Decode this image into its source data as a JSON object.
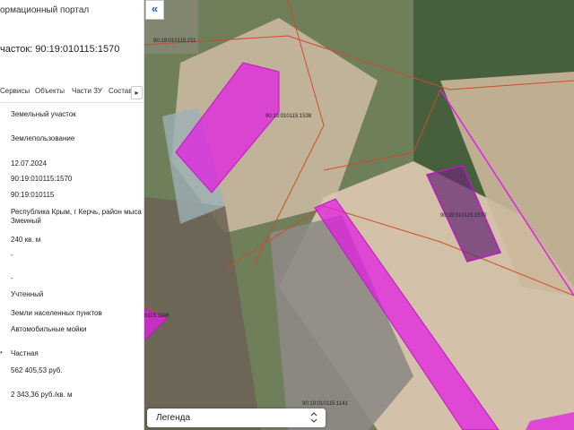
{
  "panel": {
    "portal_title": "ормационный портал",
    "parcel_title": "часток: 90:19:010115:1570",
    "tabs": [
      "Сервисы",
      "Объекты",
      "Части ЗУ",
      "Состав"
    ],
    "tabs_more": "▸",
    "info": {
      "type": "Земельный участок",
      "subtype": "Землепользование",
      "date": "12.07.2024",
      "cad_number": "90:19:010115:1570",
      "quarter": "90:19:010115",
      "address": "Республика Крым, г Керчь, район мыса Змеиный",
      "area": "240 кв. м",
      "dash1": "-",
      "dash2": "-",
      "status": "Учтенный",
      "category": "Земли населенных пунктов",
      "use": "Автомобильные мойки",
      "bullet": "•",
      "ownership": "Частная",
      "cad_value": "562 405,53 руб.",
      "unit_value": "2 343,36 руб./кв. м"
    }
  },
  "map": {
    "collapse_icon": "«",
    "labels": {
      "top": "90:19:010115:211",
      "middle": "90:19:010115:1538",
      "selected": "90:19:010115:1570",
      "left": "0115:1146",
      "bottom": "90:19:010115:1141"
    },
    "colors": {
      "parcel_fill": "#e21fe3",
      "parcel_stroke": "#c216c6",
      "boundary": "#d04b2a",
      "selected_fill": "#6a2c74"
    },
    "legend_label": "Легенда",
    "legend_icon": "chevron-updown-icon"
  }
}
